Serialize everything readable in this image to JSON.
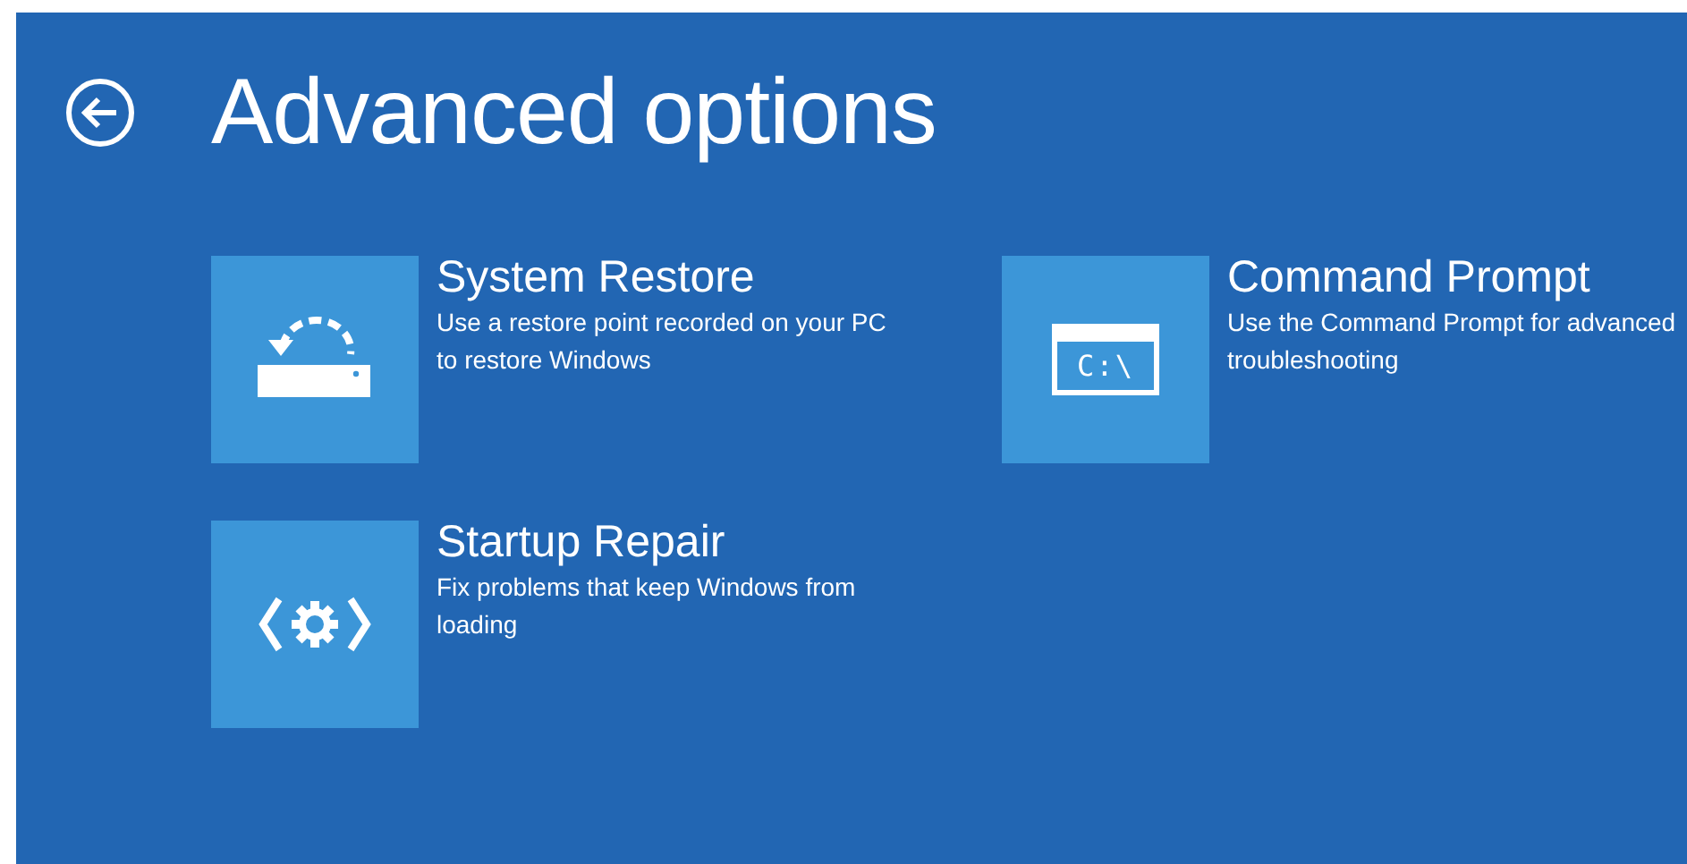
{
  "title": "Advanced options",
  "options": [
    {
      "kind": "restore",
      "title": "System Restore",
      "description": "Use a restore point recorded on your PC to restore Windows"
    },
    {
      "kind": "command",
      "title": "Command Prompt",
      "description": "Use the Command Prompt for advanced troubleshooting",
      "icon_text": "C:\\"
    },
    {
      "kind": "repair",
      "title": "Startup Repair",
      "description": "Fix problems that keep Windows from loading"
    }
  ]
}
